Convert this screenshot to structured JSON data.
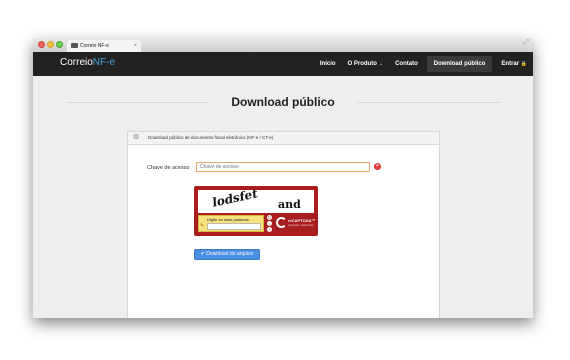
{
  "browser": {
    "tab_title": "Correio NF-e",
    "tab_close": "×",
    "resize_glyph": "⤢"
  },
  "navbar": {
    "brand_main": "Correio",
    "brand_suffix": "NF-e",
    "items": [
      {
        "label": "Início"
      },
      {
        "label": "O Produto",
        "dropdown": true,
        "caret": "⌄"
      },
      {
        "label": "Contato"
      },
      {
        "label": "Download público",
        "active": true
      },
      {
        "label": "Entrar",
        "icon": "lock-icon",
        "glyph": "🔒"
      }
    ]
  },
  "page": {
    "title": "Download público"
  },
  "panel": {
    "icon": "gear-icon",
    "icon_glyph": "⚙",
    "heading": "Download público de documento fiscal eletrônico (NF-e / CT-e)"
  },
  "form": {
    "access_key_label": "Chave de acesso",
    "access_key_placeholder": "Chave de acesso",
    "access_key_value": "",
    "error_glyph": "×"
  },
  "captcha": {
    "word1": "lodsfet",
    "word2": "and",
    "input_label": "Digite as duas palavras:",
    "input_value": "",
    "logo_text": "reCAPTCHA™",
    "logo_subtext": "stop spam. read books.",
    "buttons": [
      "↻",
      "♪",
      "?"
    ]
  },
  "download_button": {
    "icon": "check-icon",
    "label": "✔ Download do arquivo"
  },
  "colors": {
    "navbar_bg": "#222222",
    "brand_accent": "#4aa3df",
    "button_primary": "#4a90e2",
    "captcha_red": "#a81e1e",
    "error_red": "#e03333"
  }
}
